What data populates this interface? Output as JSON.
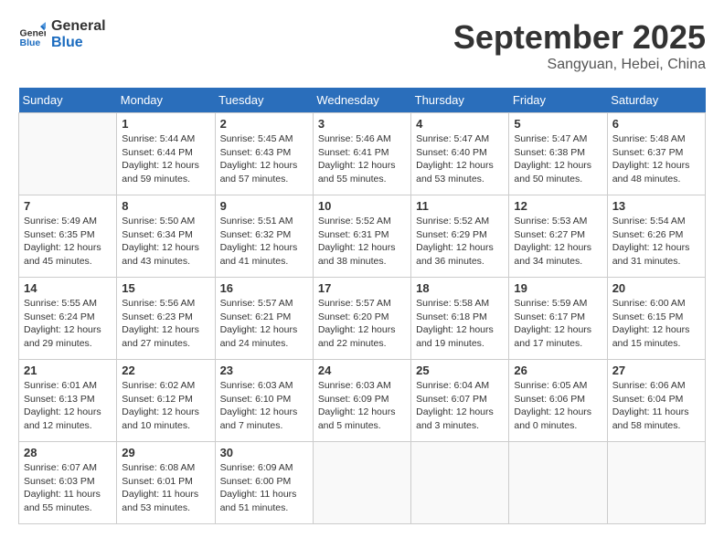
{
  "logo": {
    "line1": "General",
    "line2": "Blue"
  },
  "title": "September 2025",
  "location": "Sangyuan, Hebei, China",
  "days_of_week": [
    "Sunday",
    "Monday",
    "Tuesday",
    "Wednesday",
    "Thursday",
    "Friday",
    "Saturday"
  ],
  "weeks": [
    [
      {
        "day": "",
        "info": ""
      },
      {
        "day": "1",
        "info": "Sunrise: 5:44 AM\nSunset: 6:44 PM\nDaylight: 12 hours\nand 59 minutes."
      },
      {
        "day": "2",
        "info": "Sunrise: 5:45 AM\nSunset: 6:43 PM\nDaylight: 12 hours\nand 57 minutes."
      },
      {
        "day": "3",
        "info": "Sunrise: 5:46 AM\nSunset: 6:41 PM\nDaylight: 12 hours\nand 55 minutes."
      },
      {
        "day": "4",
        "info": "Sunrise: 5:47 AM\nSunset: 6:40 PM\nDaylight: 12 hours\nand 53 minutes."
      },
      {
        "day": "5",
        "info": "Sunrise: 5:47 AM\nSunset: 6:38 PM\nDaylight: 12 hours\nand 50 minutes."
      },
      {
        "day": "6",
        "info": "Sunrise: 5:48 AM\nSunset: 6:37 PM\nDaylight: 12 hours\nand 48 minutes."
      }
    ],
    [
      {
        "day": "7",
        "info": "Sunrise: 5:49 AM\nSunset: 6:35 PM\nDaylight: 12 hours\nand 45 minutes."
      },
      {
        "day": "8",
        "info": "Sunrise: 5:50 AM\nSunset: 6:34 PM\nDaylight: 12 hours\nand 43 minutes."
      },
      {
        "day": "9",
        "info": "Sunrise: 5:51 AM\nSunset: 6:32 PM\nDaylight: 12 hours\nand 41 minutes."
      },
      {
        "day": "10",
        "info": "Sunrise: 5:52 AM\nSunset: 6:31 PM\nDaylight: 12 hours\nand 38 minutes."
      },
      {
        "day": "11",
        "info": "Sunrise: 5:52 AM\nSunset: 6:29 PM\nDaylight: 12 hours\nand 36 minutes."
      },
      {
        "day": "12",
        "info": "Sunrise: 5:53 AM\nSunset: 6:27 PM\nDaylight: 12 hours\nand 34 minutes."
      },
      {
        "day": "13",
        "info": "Sunrise: 5:54 AM\nSunset: 6:26 PM\nDaylight: 12 hours\nand 31 minutes."
      }
    ],
    [
      {
        "day": "14",
        "info": "Sunrise: 5:55 AM\nSunset: 6:24 PM\nDaylight: 12 hours\nand 29 minutes."
      },
      {
        "day": "15",
        "info": "Sunrise: 5:56 AM\nSunset: 6:23 PM\nDaylight: 12 hours\nand 27 minutes."
      },
      {
        "day": "16",
        "info": "Sunrise: 5:57 AM\nSunset: 6:21 PM\nDaylight: 12 hours\nand 24 minutes."
      },
      {
        "day": "17",
        "info": "Sunrise: 5:57 AM\nSunset: 6:20 PM\nDaylight: 12 hours\nand 22 minutes."
      },
      {
        "day": "18",
        "info": "Sunrise: 5:58 AM\nSunset: 6:18 PM\nDaylight: 12 hours\nand 19 minutes."
      },
      {
        "day": "19",
        "info": "Sunrise: 5:59 AM\nSunset: 6:17 PM\nDaylight: 12 hours\nand 17 minutes."
      },
      {
        "day": "20",
        "info": "Sunrise: 6:00 AM\nSunset: 6:15 PM\nDaylight: 12 hours\nand 15 minutes."
      }
    ],
    [
      {
        "day": "21",
        "info": "Sunrise: 6:01 AM\nSunset: 6:13 PM\nDaylight: 12 hours\nand 12 minutes."
      },
      {
        "day": "22",
        "info": "Sunrise: 6:02 AM\nSunset: 6:12 PM\nDaylight: 12 hours\nand 10 minutes."
      },
      {
        "day": "23",
        "info": "Sunrise: 6:03 AM\nSunset: 6:10 PM\nDaylight: 12 hours\nand 7 minutes."
      },
      {
        "day": "24",
        "info": "Sunrise: 6:03 AM\nSunset: 6:09 PM\nDaylight: 12 hours\nand 5 minutes."
      },
      {
        "day": "25",
        "info": "Sunrise: 6:04 AM\nSunset: 6:07 PM\nDaylight: 12 hours\nand 3 minutes."
      },
      {
        "day": "26",
        "info": "Sunrise: 6:05 AM\nSunset: 6:06 PM\nDaylight: 12 hours\nand 0 minutes."
      },
      {
        "day": "27",
        "info": "Sunrise: 6:06 AM\nSunset: 6:04 PM\nDaylight: 11 hours\nand 58 minutes."
      }
    ],
    [
      {
        "day": "28",
        "info": "Sunrise: 6:07 AM\nSunset: 6:03 PM\nDaylight: 11 hours\nand 55 minutes."
      },
      {
        "day": "29",
        "info": "Sunrise: 6:08 AM\nSunset: 6:01 PM\nDaylight: 11 hours\nand 53 minutes."
      },
      {
        "day": "30",
        "info": "Sunrise: 6:09 AM\nSunset: 6:00 PM\nDaylight: 11 hours\nand 51 minutes."
      },
      {
        "day": "",
        "info": ""
      },
      {
        "day": "",
        "info": ""
      },
      {
        "day": "",
        "info": ""
      },
      {
        "day": "",
        "info": ""
      }
    ]
  ]
}
